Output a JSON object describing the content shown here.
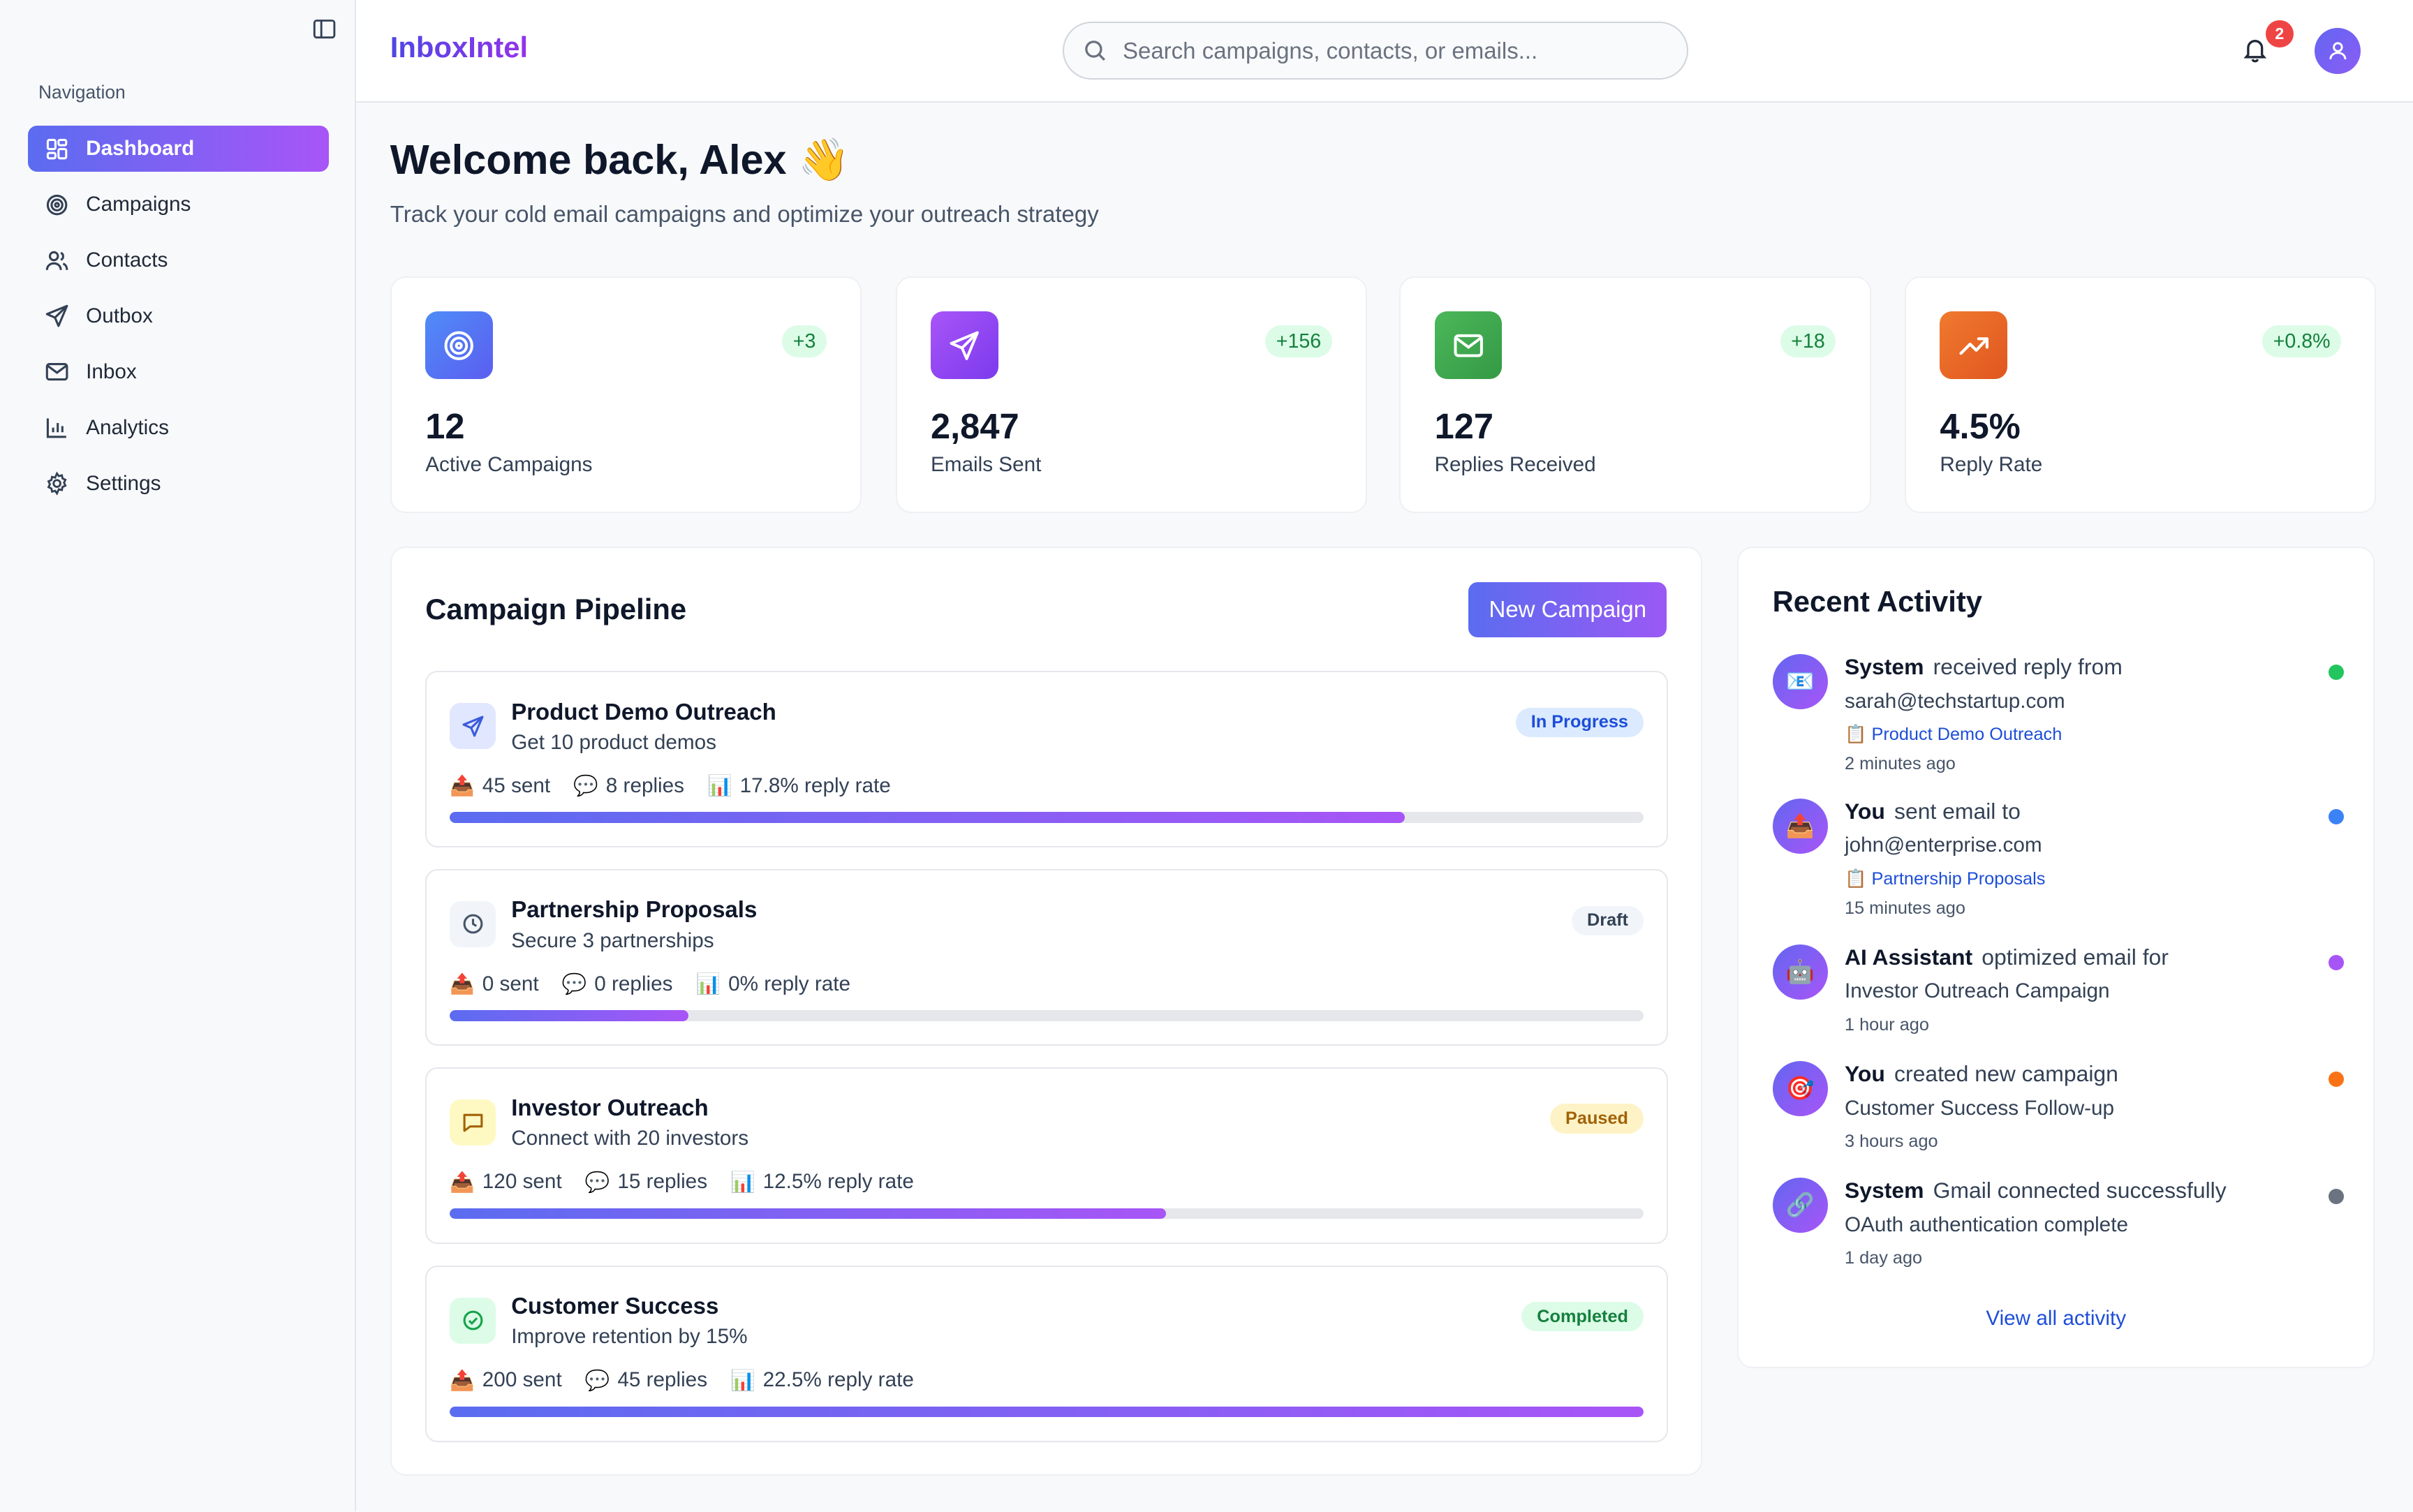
{
  "app": {
    "brand": "InboxIntel"
  },
  "sidebar": {
    "heading": "Navigation",
    "items": [
      {
        "label": "Dashboard",
        "icon": "grid-icon",
        "active": true
      },
      {
        "label": "Campaigns",
        "icon": "target-icon"
      },
      {
        "label": "Contacts",
        "icon": "users-icon"
      },
      {
        "label": "Outbox",
        "icon": "send-icon"
      },
      {
        "label": "Inbox",
        "icon": "mail-icon"
      },
      {
        "label": "Analytics",
        "icon": "bar-chart-icon"
      },
      {
        "label": "Settings",
        "icon": "gear-icon"
      }
    ]
  },
  "header": {
    "search_placeholder": "Search campaigns, contacts, or emails...",
    "notification_count": "2"
  },
  "welcome": {
    "title": "Welcome back, Alex 👋",
    "subtitle": "Track your cold email campaigns and optimize your outreach strategy"
  },
  "stats": [
    {
      "value": "12",
      "label": "Active Campaigns",
      "delta": "+3",
      "icon": "target-icon",
      "color": "#4f7cf0"
    },
    {
      "value": "2,847",
      "label": "Emails Sent",
      "delta": "+156",
      "icon": "send-icon",
      "color": "#9b4df2"
    },
    {
      "value": "127",
      "label": "Replies Received",
      "delta": "+18",
      "icon": "mail-icon",
      "color": "#43a452"
    },
    {
      "value": "4.5%",
      "label": "Reply Rate",
      "delta": "+0.8%",
      "icon": "trending-up-icon",
      "color": "#ea6c2a"
    }
  ],
  "pipeline": {
    "title": "Campaign Pipeline",
    "new_button": "New Campaign",
    "campaigns": [
      {
        "name": "Product Demo Outreach",
        "goal": "Get 10 product demos",
        "status": "In Progress",
        "sent": "45 sent",
        "replies": "8 replies",
        "rate": "17.8% reply rate",
        "progress": 0.8,
        "icon": "send-icon"
      },
      {
        "name": "Partnership Proposals",
        "goal": "Secure 3 partnerships",
        "status": "Draft",
        "sent": "0 sent",
        "replies": "0 replies",
        "rate": "0% reply rate",
        "progress": 0.2,
        "icon": "clock-icon"
      },
      {
        "name": "Investor Outreach",
        "goal": "Connect with 20 investors",
        "status": "Paused",
        "sent": "120 sent",
        "replies": "15 replies",
        "rate": "12.5% reply rate",
        "progress": 0.6,
        "icon": "message-icon"
      },
      {
        "name": "Customer Success",
        "goal": "Improve retention by 15%",
        "status": "Completed",
        "sent": "200 sent",
        "replies": "45 replies",
        "rate": "22.5% reply rate",
        "progress": 1.0,
        "icon": "check-circle-icon"
      }
    ]
  },
  "activity": {
    "title": "Recent Activity",
    "view_all": "View all activity",
    "items": [
      {
        "actor": "System",
        "action": "received reply from",
        "detail": "sarah@techstartup.com",
        "campaign": "📋 Product Demo Outreach",
        "time": "2 minutes ago",
        "emoji": "📧",
        "dot": "#22c55e"
      },
      {
        "actor": "You",
        "action": "sent email to",
        "detail": "john@enterprise.com",
        "campaign": "📋 Partnership Proposals",
        "time": "15 minutes ago",
        "emoji": "📤",
        "dot": "#3b82f6"
      },
      {
        "actor": "AI Assistant",
        "action": "optimized email for",
        "detail": "Investor Outreach Campaign",
        "campaign": "",
        "time": "1 hour ago",
        "emoji": "🤖",
        "dot": "#a855f7"
      },
      {
        "actor": "You",
        "action": "created new campaign",
        "detail": "Customer Success Follow-up",
        "campaign": "",
        "time": "3 hours ago",
        "emoji": "🎯",
        "dot": "#f97316"
      },
      {
        "actor": "System",
        "action": "Gmail connected successfully",
        "detail": "OAuth authentication complete",
        "campaign": "",
        "time": "1 day ago",
        "emoji": "🔗",
        "dot": "#6b7280"
      }
    ]
  }
}
